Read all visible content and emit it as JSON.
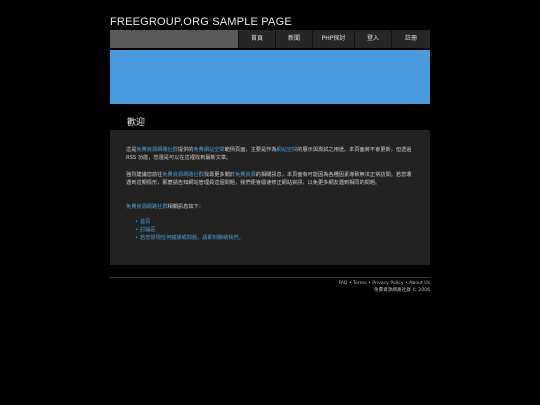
{
  "site": {
    "title": "FREEGROUP.ORG SAMPLE PAGE"
  },
  "nav": {
    "items": [
      {
        "label": "首頁"
      },
      {
        "label": "新聞"
      },
      {
        "label": "PHP探討"
      },
      {
        "label": "登入"
      },
      {
        "label": "註冊"
      }
    ]
  },
  "colors": {
    "banner": "#4a9bdd",
    "link": "#4d9fd6",
    "content_bg": "#222222",
    "nav_bg": "#262626"
  },
  "main": {
    "heading": "歡迎",
    "p1": {
      "a": "這是",
      "link1": "免費資源網路社群",
      "b": "提供的",
      "link2": "免費網站空間",
      "c": "範例頁面，主要是作為",
      "link3": "網站空間",
      "d": "的展示與測試之用途。本頁面將不會更新，但透過 RSS 功能，您還是可以在這裡找到最新文章。"
    },
    "p2": {
      "a": "強烈建議您前往",
      "link1": "免費資源網路社群",
      "b": "找尋更多關於",
      "link2": "免費資源",
      "c": "的相關訊息，本頁面有可能因為各種因素導致無法正常訪問。若您遭遇到這類情形，那麼請告知網站管理員這個問題，我們便會儘速修正網站資訊，以免更多網友遇到相同的問題。"
    },
    "p3": {
      "link1": "免費資源網路社群",
      "a": "相關訊息如下："
    },
    "list": [
      {
        "label": "首頁"
      },
      {
        "label": "討論區"
      },
      {
        "label": "若您發現任何錯誤或問題，請即刻聯絡我們。"
      }
    ]
  },
  "footer": {
    "links": [
      "FAQ",
      "Terms",
      "Privacy Policy",
      "About Us"
    ],
    "separator": " • ",
    "copyright": "免費資源網路社群 © 2006"
  }
}
